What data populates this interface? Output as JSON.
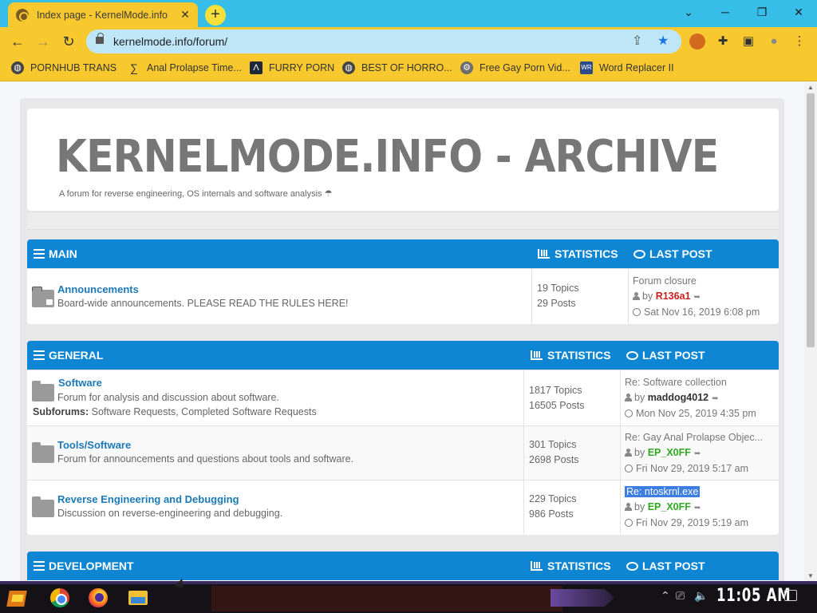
{
  "browser": {
    "tab_title": "Index page - KernelMode.info",
    "tab_close": "✕",
    "new_tab": "+",
    "url": "kernelmode.info/forum/",
    "window_controls": {
      "collapse": "⌄",
      "minimize": "─",
      "restore": "❐",
      "close": "✕"
    },
    "nav": {
      "back": "←",
      "forward": "→",
      "reload": "↻"
    },
    "omnibox_icons": {
      "share": "⇪",
      "star": "★"
    },
    "toolbar_icons": {
      "extensions": "✚",
      "sidebar": "▣",
      "profile": "●",
      "menu": "⋮"
    }
  },
  "bookmarks": [
    {
      "label": "PORNHUB TRANS",
      "icon": "globe-icon"
    },
    {
      "label": "Anal Prolapse Time...",
      "icon": "sigma-icon"
    },
    {
      "label": "FURRY PORN",
      "icon": "triangle-icon"
    },
    {
      "label": "BEST OF HORRO...",
      "icon": "globe-icon"
    },
    {
      "label": "Free Gay Porn Vid...",
      "icon": "gear-icon"
    },
    {
      "label": "Word Replacer II",
      "icon": "wr-icon"
    }
  ],
  "site": {
    "title": "KERNELMODE.INFO - ARCHIVE",
    "description": "A forum for reverse engineering, OS internals and software analysis ☂"
  },
  "sections": [
    {
      "name": "MAIN",
      "stats_label": "STATISTICS",
      "last_label": "LAST POST",
      "forums": [
        {
          "title": "Announcements",
          "desc": "Board-wide announcements. PLEASE READ THE RULES HERE!",
          "topics": "19 Topics",
          "posts": "29 Posts",
          "last_title": "Forum closure",
          "last_by": "by",
          "last_user": "R136a1",
          "last_date": "Sat Nov 16, 2019 6:08 pm"
        }
      ]
    },
    {
      "name": "GENERAL",
      "stats_label": "STATISTICS",
      "last_label": "LAST POST",
      "forums": [
        {
          "title": "Software",
          "desc": "Forum for analysis and discussion about software.",
          "sub_label": "Subforums:",
          "sub_list": "Software Requests, Completed Software Requests",
          "topics": "1817 Topics",
          "posts": "16505 Posts",
          "last_title": "Re: Software collection",
          "last_by": "by",
          "last_user": "maddog4012",
          "last_date": "Mon Nov 25, 2019 4:35 pm"
        },
        {
          "title": "Tools/Software",
          "desc": "Forum for announcements and questions about tools and software.",
          "topics": "301 Topics",
          "posts": "2698 Posts",
          "last_title": "Re: Gay Anal Prolapse Objec...",
          "last_by": "by",
          "last_user": "EP_X0FF",
          "last_date": "Fri Nov 29, 2019 5:17 am"
        },
        {
          "title": "Reverse Engineering and Debugging",
          "desc": "Discussion on reverse-engineering and debugging.",
          "topics": "229 Topics",
          "posts": "986 Posts",
          "last_title": "Re: ntoskrnl.exe",
          "last_by": "by",
          "last_user": "EP_X0FF",
          "last_date": "Fri Nov 29, 2019 5:19 am"
        }
      ]
    },
    {
      "name": "DEVELOPMENT",
      "stats_label": "STATISTICS",
      "last_label": "LAST POST",
      "forums": []
    }
  ],
  "taskbar": {
    "clock": "11:05 AM",
    "tray_icons": {
      "chevron": "⌃",
      "network": "⎚",
      "volume": "🔈"
    }
  }
}
